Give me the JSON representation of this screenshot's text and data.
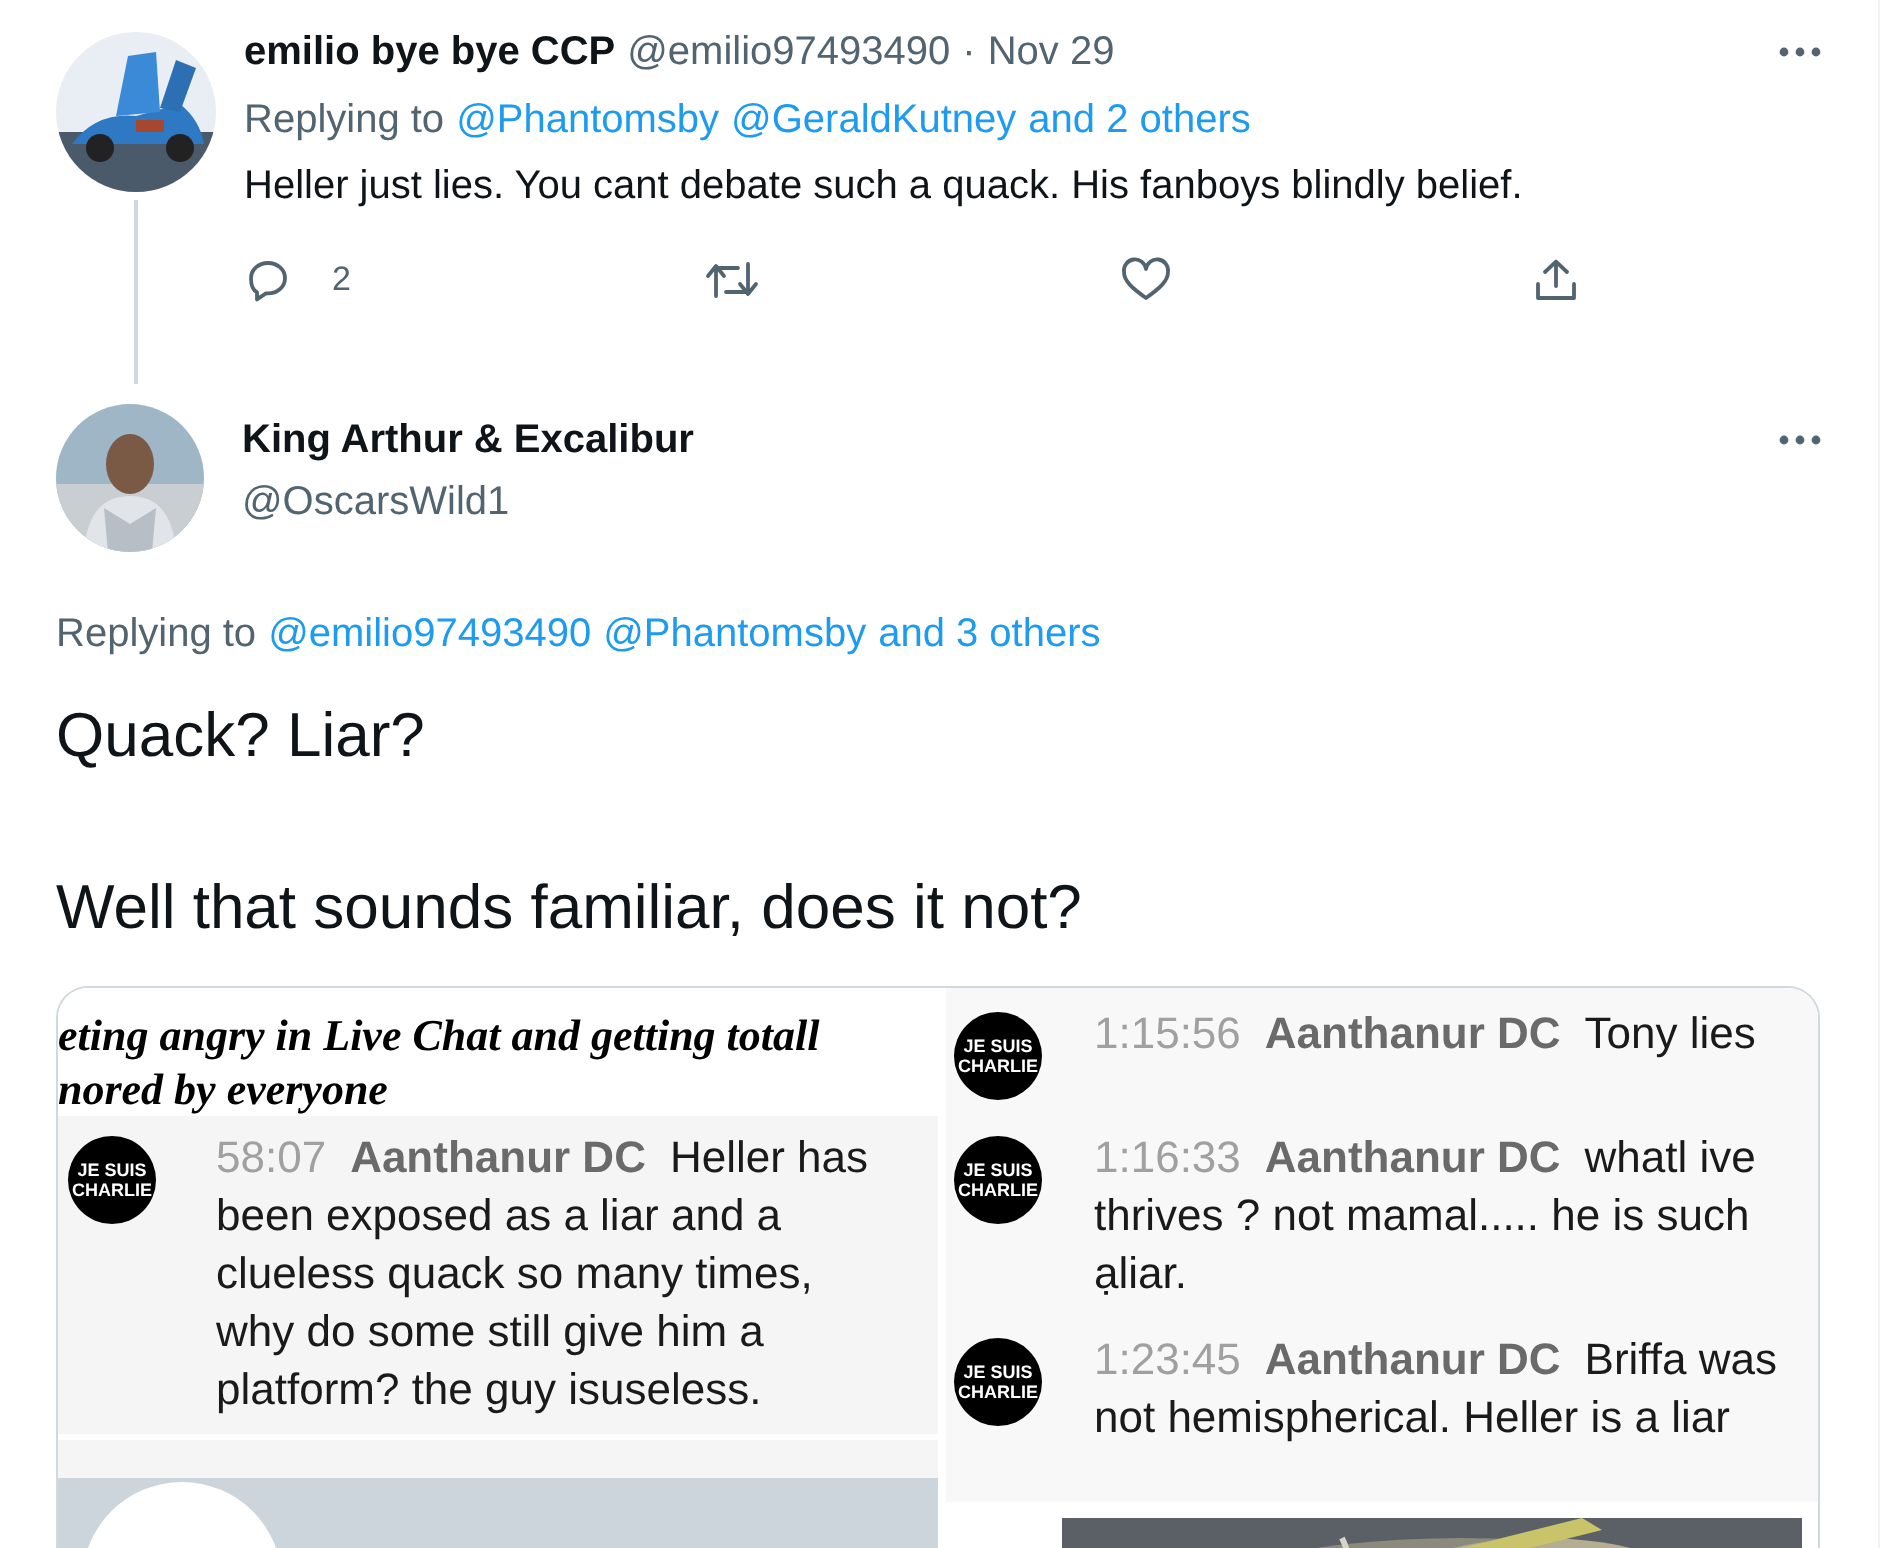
{
  "parent_tweet": {
    "name": "emilio bye bye CCP",
    "handle": "@emilio97493490",
    "separator": "·",
    "date": "Nov 29",
    "replying_prefix": "Replying to",
    "replying_to": [
      "@Phantomsby",
      "@GeraldKutney",
      "and 2 others"
    ],
    "text": "Heller just lies. You cant debate such a quack. His fanboys blindly belief.",
    "reply_count": "2"
  },
  "main_tweet": {
    "name": "King Arthur & Excalibur",
    "handle": "@OscarsWild1",
    "replying_prefix": "Replying to",
    "replying_to": [
      "@emilio97493490",
      "@Phantomsby",
      "and 3 others"
    ],
    "paragraphs": [
      "Quack? Liar?",
      "Well that sounds familiar, does it not?"
    ]
  },
  "media": {
    "left_image": {
      "caption_lines": [
        "eting angry in Live Chat and getting totall",
        "nored by everyone"
      ],
      "messages": [
        {
          "avatar": [
            "JE SUIS",
            "CHARLIE"
          ],
          "time": "58:07",
          "author": "Aanthanur DC",
          "text": "Heller has been exposed as a liar and a clueless quack so many times, why do some still give him a platform? the guy isuseless."
        }
      ]
    },
    "right_image": {
      "messages": [
        {
          "avatar": [
            "JE SUIS",
            "CHARLIE"
          ],
          "time": "1:15:56",
          "author": "Aanthanur DC",
          "text": "Tony lies"
        },
        {
          "avatar": [
            "JE SUIS",
            "CHARLIE"
          ],
          "time": "1:16:33",
          "author": "Aanthanur DC",
          "text": "whatl ive thrives ? not mamal..... he is such ạliar."
        },
        {
          "avatar": [
            "JE SUIS",
            "CHARLIE"
          ],
          "time": "1:23:45",
          "author": "Aanthanur DC",
          "text": "Briffa was not hemispherical. Heller is a liar"
        }
      ]
    }
  }
}
